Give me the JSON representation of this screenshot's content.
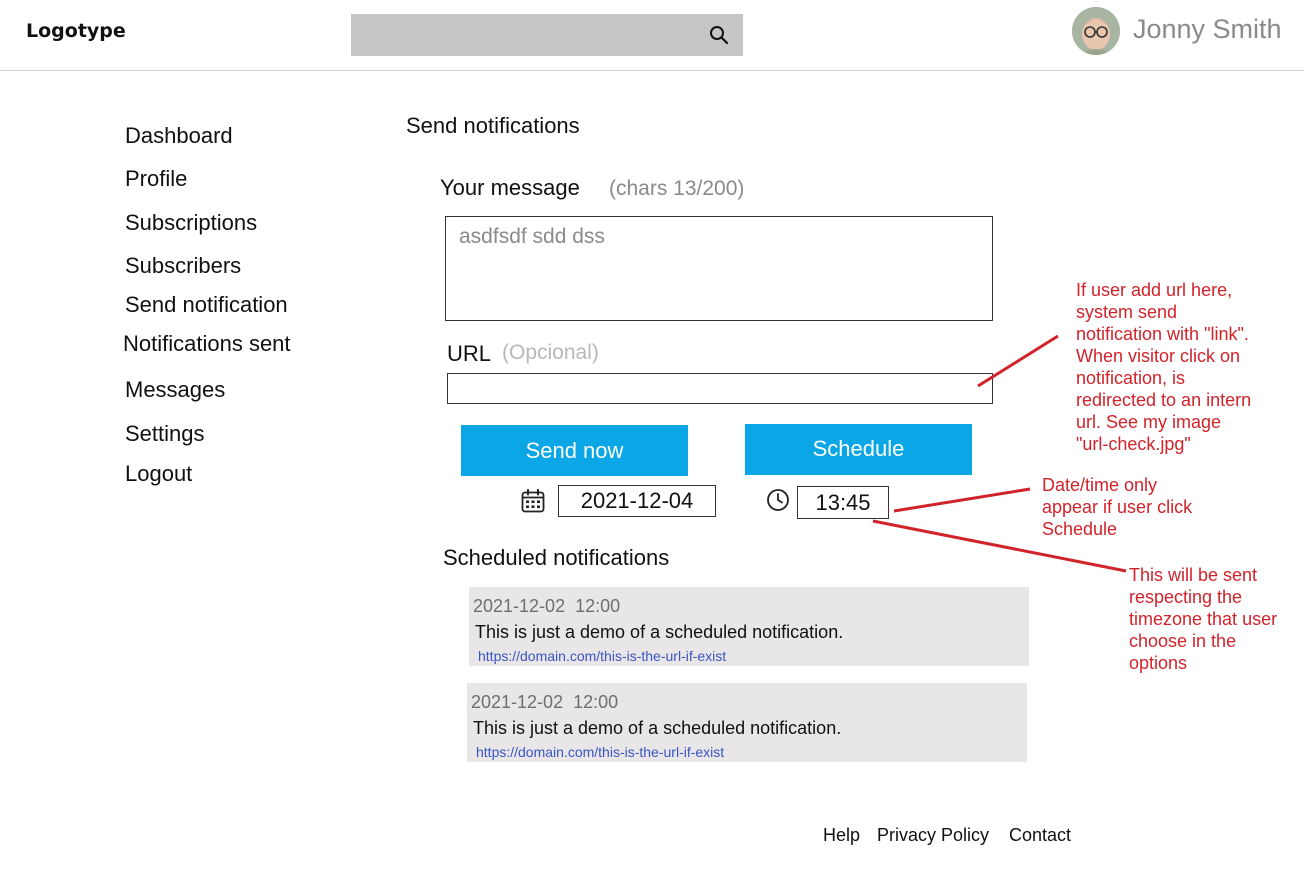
{
  "header": {
    "logo": "Logotype",
    "search_icon": "search-icon",
    "user_name": "Jonny Smith"
  },
  "sidebar": {
    "items": [
      {
        "label": "Dashboard"
      },
      {
        "label": "Profile"
      },
      {
        "label": "Subscriptions"
      },
      {
        "label": "Subscribers"
      },
      {
        "label": "Send notification"
      },
      {
        "label": "Notifications sent"
      },
      {
        "label": "Messages"
      },
      {
        "label": "Settings"
      },
      {
        "label": "Logout"
      }
    ]
  },
  "main": {
    "title": "Send notifications",
    "message": {
      "label": "Your message",
      "counter": "(chars 13/200)",
      "value": "asdfsdf sdd dss"
    },
    "url": {
      "label": "URL",
      "optional_hint": "(Opcional)",
      "value": ""
    },
    "buttons": {
      "send_now": "Send now",
      "schedule": "Schedule"
    },
    "schedule_date": "2021-12-04",
    "schedule_time": "13:45",
    "scheduled": {
      "title": "Scheduled notifications",
      "items": [
        {
          "datetime": "2021-12-02  12:00",
          "text": "This is just a demo of a scheduled notification.",
          "url": "https://domain.com/this-is-the-url-if-exist"
        },
        {
          "datetime": "2021-12-02  12:00",
          "text": "This is just a demo of a scheduled notification.",
          "url": "https://domain.com/this-is-the-url-if-exist"
        }
      ]
    }
  },
  "footer": {
    "help": "Help",
    "privacy": "Privacy Policy",
    "contact": "Contact"
  },
  "annotations": {
    "url_note": [
      "If user add url here,",
      "system send",
      "notification with \"link\".",
      "When visitor click on",
      "notification, is",
      "redirected to an intern",
      "url. See my image",
      "\"url-check.jpg\""
    ],
    "datetime_note": [
      "Date/time only",
      "appear if user click",
      "Schedule"
    ],
    "timezone_note": [
      "This will be sent",
      "respecting the",
      "timezone that user",
      "choose in the",
      "options"
    ],
    "color": "#d1232a"
  },
  "colors": {
    "primary_button": "#0aa6e6",
    "search_bar": "#c6c6c6",
    "card_bg": "#e8e6e7",
    "link": "#3b55c4"
  }
}
